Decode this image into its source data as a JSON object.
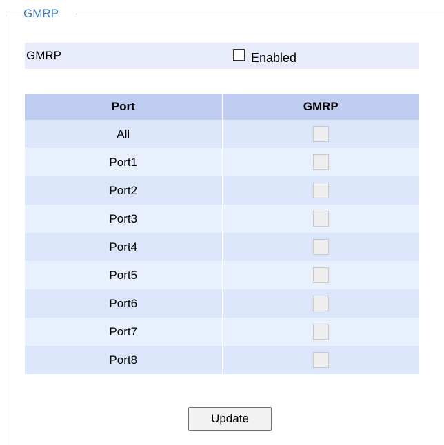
{
  "legend": "GMRP",
  "setting": {
    "label": "GMRP",
    "enabled_label": "Enabled",
    "enabled": false
  },
  "table": {
    "headers": [
      "Port",
      "GMRP"
    ],
    "rows": [
      {
        "port": "All",
        "checked": false,
        "disabled": true
      },
      {
        "port": "Port1",
        "checked": false,
        "disabled": true
      },
      {
        "port": "Port2",
        "checked": false,
        "disabled": true
      },
      {
        "port": "Port3",
        "checked": false,
        "disabled": true
      },
      {
        "port": "Port4",
        "checked": false,
        "disabled": true
      },
      {
        "port": "Port5",
        "checked": false,
        "disabled": true
      },
      {
        "port": "Port6",
        "checked": false,
        "disabled": true
      },
      {
        "port": "Port7",
        "checked": false,
        "disabled": true
      },
      {
        "port": "Port8",
        "checked": false,
        "disabled": true
      }
    ]
  },
  "buttons": {
    "update": "Update"
  },
  "colors": {
    "legend": "#2f7fd6",
    "header_bg": "#bfcdf0",
    "row_odd": "#dbe6fb",
    "row_even": "#e9f0fd",
    "setting_bg": "#e8ecfa"
  }
}
